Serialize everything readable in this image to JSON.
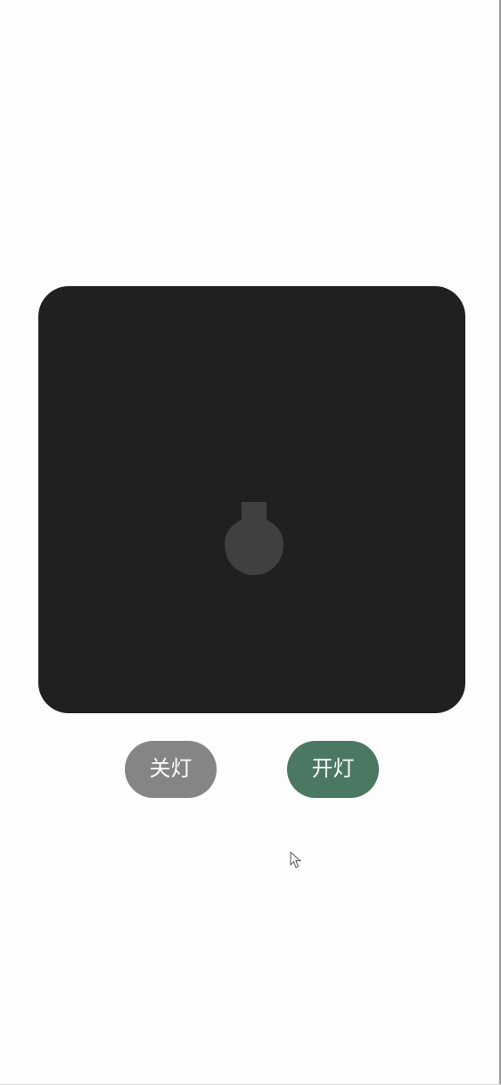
{
  "light": {
    "state": "off",
    "panel_color": "#202020",
    "bulb_color": "#404040"
  },
  "buttons": {
    "off_label": "关灯",
    "on_label": "开灯",
    "off_color": "#858585",
    "on_color": "#4a7863"
  },
  "icons": {
    "bulb": "light-bulb-icon",
    "cursor": "mouse-pointer-icon"
  }
}
